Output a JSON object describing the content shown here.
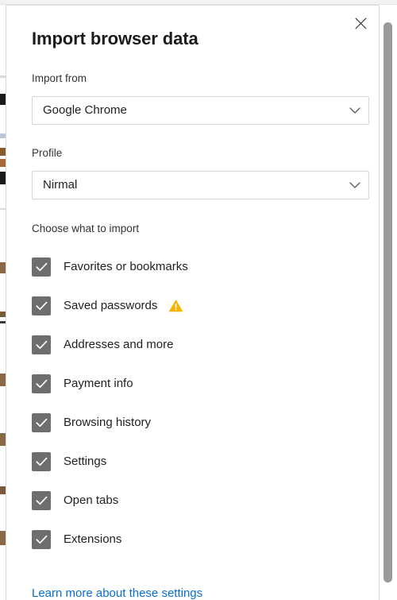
{
  "dialog": {
    "title": "Import browser data",
    "close_label": "Close",
    "close_icon": "close-icon"
  },
  "fields": {
    "import_from": {
      "label": "Import from",
      "value": "Google Chrome",
      "chevron_icon": "chevron-down-icon"
    },
    "profile": {
      "label": "Profile",
      "value": "Nirmal",
      "chevron_icon": "chevron-down-icon"
    }
  },
  "choose": {
    "label": "Choose what to import",
    "items": [
      {
        "label": "Favorites or bookmarks",
        "checked": true,
        "warning": false
      },
      {
        "label": "Saved passwords",
        "checked": true,
        "warning": true
      },
      {
        "label": "Addresses and more",
        "checked": true,
        "warning": false
      },
      {
        "label": "Payment info",
        "checked": true,
        "warning": false
      },
      {
        "label": "Browsing history",
        "checked": true,
        "warning": false
      },
      {
        "label": "Settings",
        "checked": true,
        "warning": false
      },
      {
        "label": "Open tabs",
        "checked": true,
        "warning": false
      },
      {
        "label": "Extensions",
        "checked": true,
        "warning": false
      }
    ],
    "warning_icon": "warning-triangle-icon"
  },
  "footer": {
    "learn_more": "Learn more about these settings"
  },
  "colors": {
    "dialog_background": "#ffffff",
    "page_background": "#f3f3f3",
    "title_text": "#1b1b1b",
    "body_text": "#1f1f1f",
    "label_text": "#333333",
    "checkbox_fill": "#6e6e6e",
    "checkmark": "#ffffff",
    "warning_amber": "#f7b500",
    "link_blue": "#0a6ed1",
    "border": "#d6d6d6",
    "scrollbar_thumb": "#9a9a9a"
  },
  "scrollbar": {
    "name": "vertical-scrollbar"
  }
}
